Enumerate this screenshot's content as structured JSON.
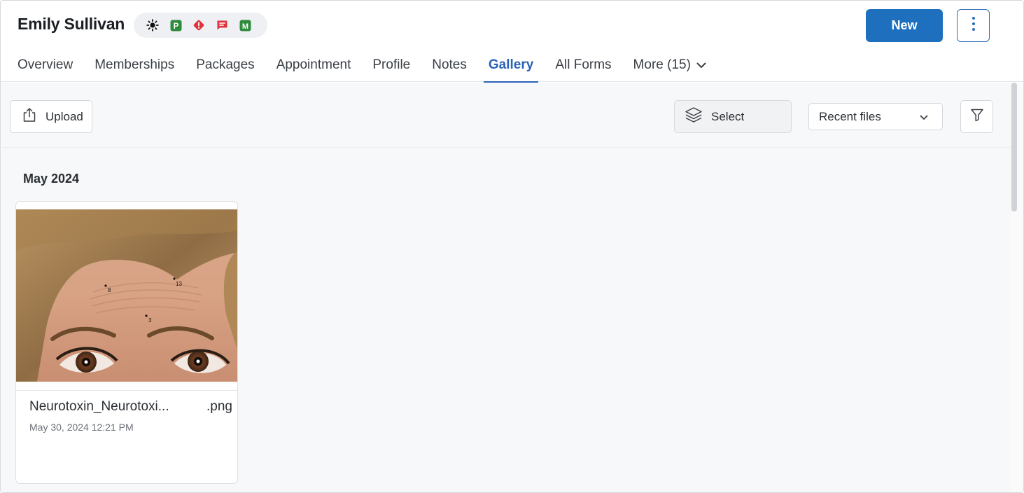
{
  "header": {
    "patient_name": "Emily Sullivan",
    "badges": [
      {
        "icon": "sun-icon",
        "text": "",
        "color": "#111111"
      },
      {
        "icon": "p-badge-icon",
        "text": "P",
        "color": "#2e8b3d"
      },
      {
        "icon": "alert-icon",
        "text": "!",
        "color": "#e0323c"
      },
      {
        "icon": "message-icon",
        "text": "",
        "color": "#e0323c"
      },
      {
        "icon": "m-badge-icon",
        "text": "M",
        "color": "#2e8b3d"
      }
    ],
    "new_button_label": "New",
    "more_actions_icon": "kebab-icon"
  },
  "tabs": [
    {
      "label": "Overview",
      "active": false
    },
    {
      "label": "Memberships",
      "active": false
    },
    {
      "label": "Packages",
      "active": false
    },
    {
      "label": "Appointment",
      "active": false
    },
    {
      "label": "Profile",
      "active": false
    },
    {
      "label": "Notes",
      "active": false
    },
    {
      "label": "Gallery",
      "active": true
    },
    {
      "label": "All Forms",
      "active": false
    },
    {
      "label": "More (15)",
      "active": false
    }
  ],
  "toolbar": {
    "upload_label": "Upload",
    "select_label": "Select",
    "sort_value": "Recent files"
  },
  "gallery": {
    "month_heading": "May 2024",
    "items": [
      {
        "filename_stem": "Neurotoxin_Neurotoxi...",
        "extension": ".png",
        "date": "May 30, 2024 12:21 PM",
        "image_labels": [
          "8",
          "13",
          "3"
        ]
      }
    ]
  },
  "colors": {
    "accent": "#1f6fbf",
    "active_tab": "#2c62b6"
  }
}
